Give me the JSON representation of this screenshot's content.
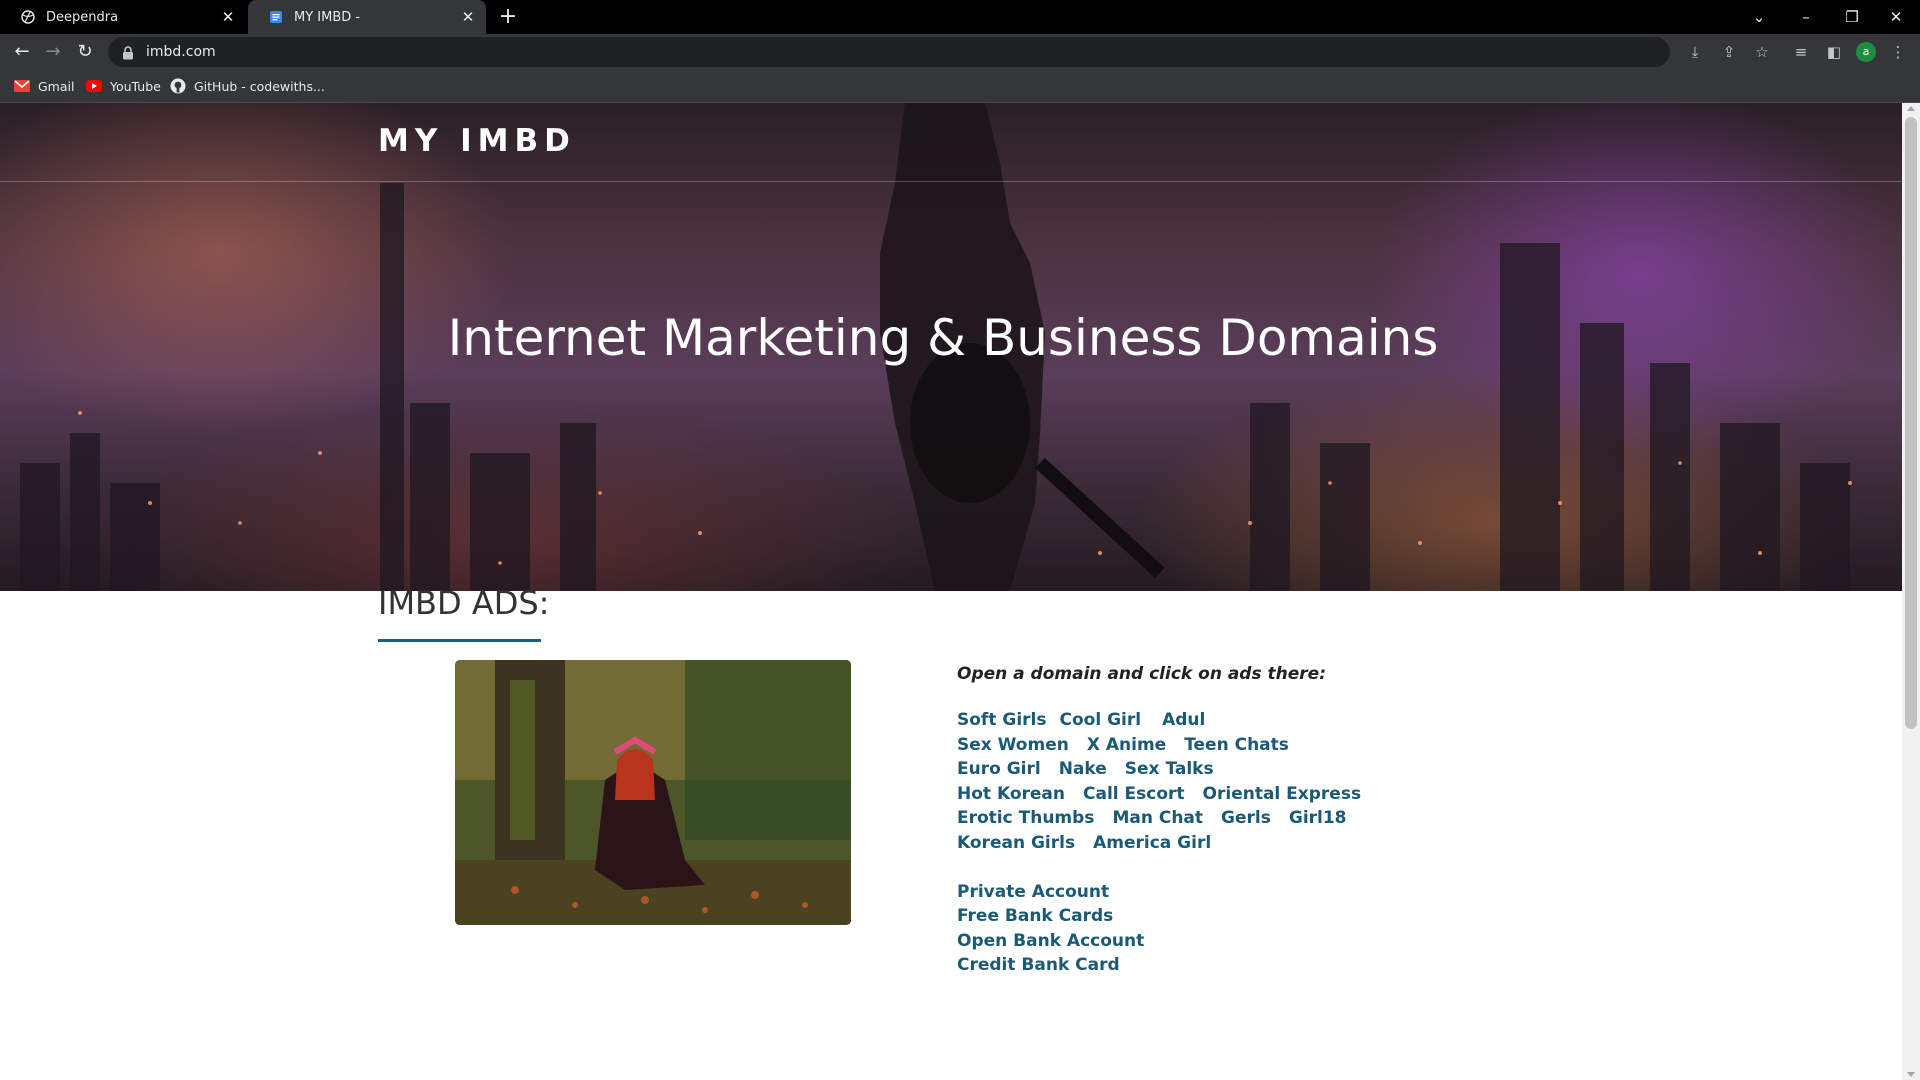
{
  "browser": {
    "tabs": [
      {
        "title": "Deependra",
        "active": false
      },
      {
        "title": "MY IMBD -",
        "active": true
      }
    ],
    "url": "imbd.com",
    "bookmarks": [
      {
        "label": "Gmail",
        "icon": "gmail-icon"
      },
      {
        "label": "YouTube",
        "icon": "youtube-icon"
      },
      {
        "label": "GitHub - codewiths...",
        "icon": "github-icon"
      }
    ],
    "profile_initial": "a"
  },
  "site": {
    "logo": "MY IMBD",
    "headline": "Internet Marketing & Business Domains",
    "section_title": "IMBD ADS:",
    "intro": "Open a domain and click on ads there:",
    "link_rows": [
      [
        "Soft Girls",
        "Cool Girl",
        "Adul"
      ],
      [
        "Sex Women",
        "X Anime",
        "Teen Chats"
      ],
      [
        "Euro Girl",
        "Nake",
        "Sex Talks"
      ],
      [
        "Hot Korean",
        "Call Escort",
        "Oriental Express"
      ],
      [
        "Erotic Thumbs",
        "Man Chat",
        "Gerls",
        "Girl18"
      ],
      [
        "Korean Girls",
        "America Girl"
      ]
    ],
    "account_links": [
      "Private Account",
      "Free Bank Cards",
      "Open Bank Account",
      "Credit Bank Card"
    ]
  },
  "colors": {
    "link": "#1a5a77",
    "accent_underline": "#136480"
  }
}
